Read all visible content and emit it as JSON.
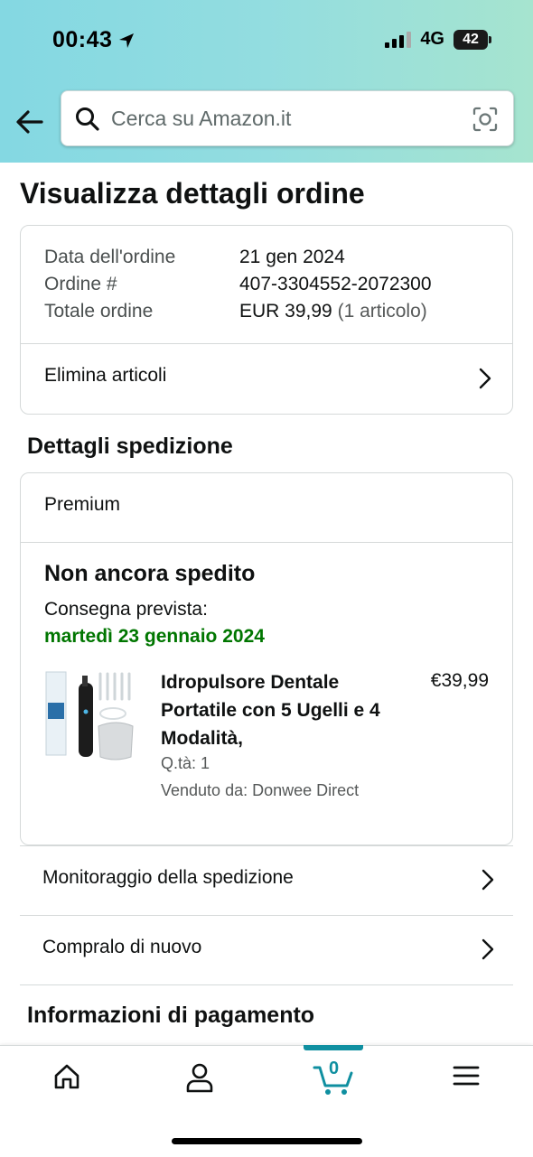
{
  "status_bar": {
    "time": "00:43",
    "network": "4G",
    "battery": "42"
  },
  "search": {
    "placeholder": "Cerca su Amazon.it"
  },
  "page": {
    "title": "Visualizza dettagli ordine"
  },
  "order_summary": {
    "rows": [
      {
        "label": "Data dell'ordine",
        "value": "21 gen 2024",
        "extra": ""
      },
      {
        "label": "Ordine #",
        "value": "407-3304552-2072300",
        "extra": ""
      },
      {
        "label": "Totale ordine",
        "value": "EUR 39,99",
        "extra": "(1 articolo)"
      }
    ],
    "delete_items_label": "Elimina articoli"
  },
  "shipping": {
    "section_title": "Dettagli spedizione",
    "shipping_type": "Premium",
    "status": "Non ancora spedito",
    "delivery_label": "Consegna prevista:",
    "delivery_date": "martedì 23 gennaio 2024",
    "accent_color": "#007600",
    "product": {
      "title": "Idropulsore Dentale Portatile con 5 Ugelli e 4 Modalità,",
      "price": "€39,99",
      "quantity": "Q.tà: 1",
      "seller": "Venduto da: Donwee Direct"
    }
  },
  "actions": {
    "track_shipment": "Monitoraggio della spedizione",
    "buy_again": "Compralo di nuovo"
  },
  "payment": {
    "section_title": "Informazioni di pagamento"
  },
  "bottom_nav": {
    "items": [
      {
        "name": "home",
        "icon": "home-icon"
      },
      {
        "name": "account",
        "icon": "person-icon"
      },
      {
        "name": "cart",
        "icon": "cart-icon"
      },
      {
        "name": "menu",
        "icon": "menu-icon"
      }
    ],
    "cart_count": "0",
    "active_color": "#0f8fa0"
  }
}
